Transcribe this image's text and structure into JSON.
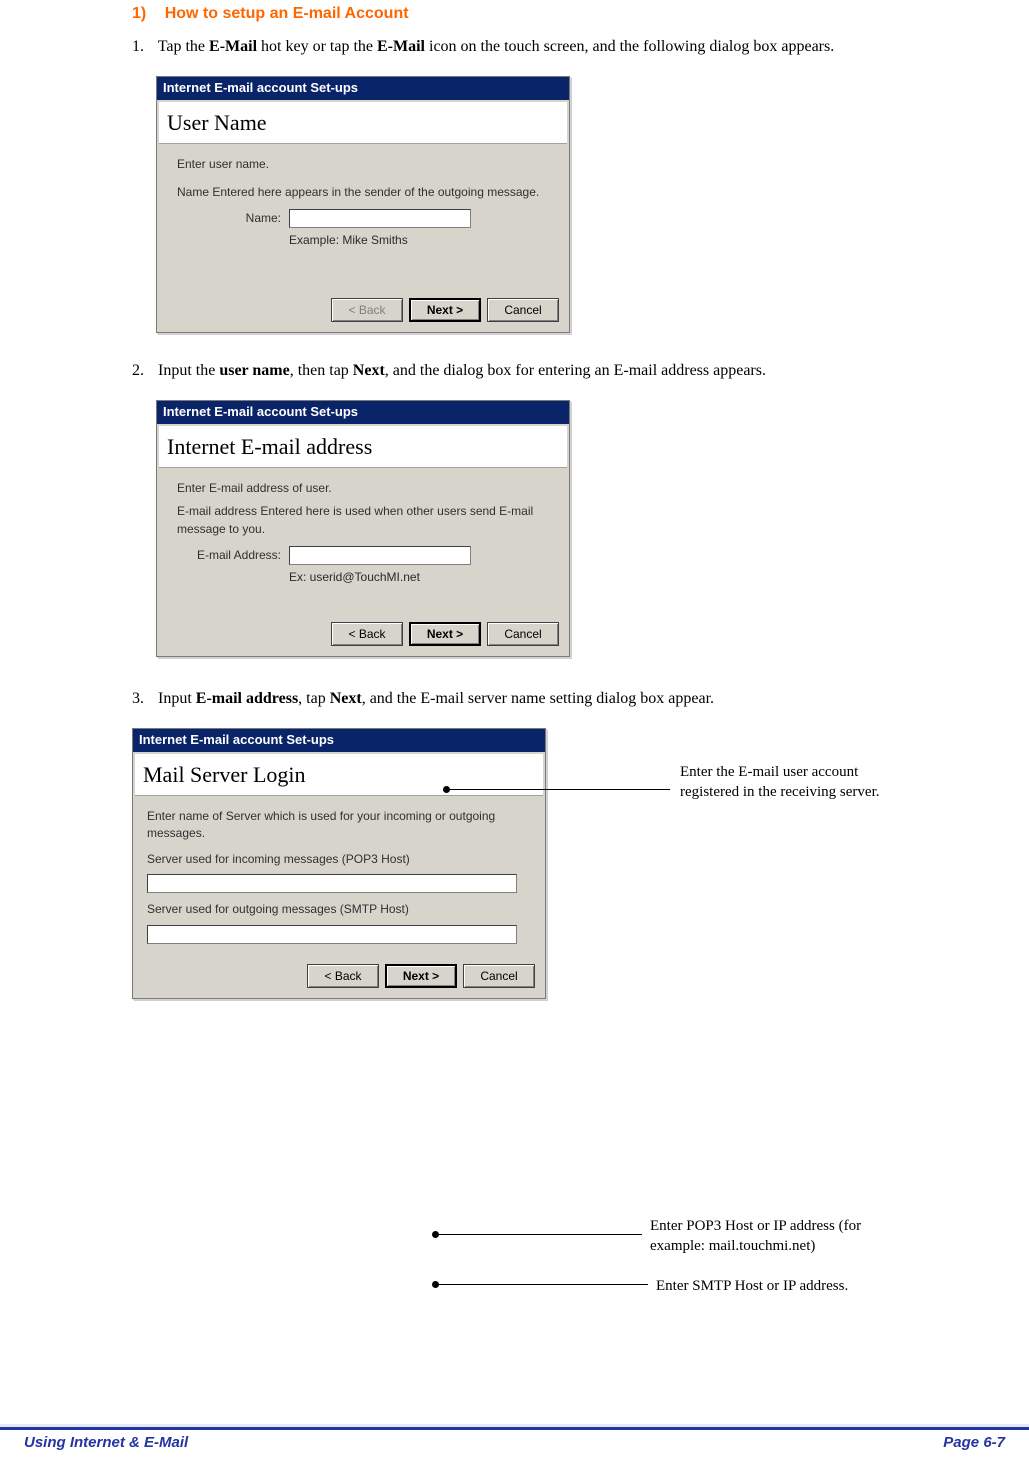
{
  "heading": {
    "num": "1)",
    "text": "How to setup an E-mail Account"
  },
  "steps": {
    "s1_prefix": "1.",
    "s1_a": "Tap the ",
    "s1_b": "E-Mail",
    "s1_c": " hot key or tap the ",
    "s1_d": "E-Mail",
    "s1_e": " icon on the touch screen, and the following dialog box appears.",
    "s2_prefix": "2.",
    "s2_a": "Input the ",
    "s2_b": "user name",
    "s2_c": ", then tap ",
    "s2_d": "Next",
    "s2_e": ", and the dialog box for entering an E-mail address appears.",
    "s3_prefix": "3.",
    "s3_a": "Input ",
    "s3_b": "E-mail address",
    "s3_c": ", tap ",
    "s3_d": "Next",
    "s3_e": ", and the E-mail server name setting dialog box appear."
  },
  "dialogs": {
    "common_title": "Internet E-mail account Set-ups",
    "buttons": {
      "back": "<  Back",
      "next": "Next  >",
      "cancel": "Cancel"
    },
    "d1": {
      "heading": "User Name",
      "line1": "Enter user name.",
      "line2": "Name Entered here appears in the sender of the outgoing message.",
      "field_label": "Name:",
      "example": "Example: Mike Smiths",
      "value": ""
    },
    "d2": {
      "heading": "Internet E-mail address",
      "line1": "Enter E-mail address of user.",
      "line2": "E-mail address Entered here is used when other users send E-mail message to you.",
      "field_label": "E-mail Address:",
      "example": "Ex: userid@TouchMI.net",
      "value": ""
    },
    "d3": {
      "heading": "Mail Server Login",
      "line1": "Enter name of Server which is used for your incoming or outgoing messages.",
      "pop3_label": "Server used for incoming messages (POP3 Host)",
      "smtp_label": "Server used for outgoing messages (SMTP Host)",
      "pop3_value": "",
      "smtp_value": ""
    }
  },
  "callouts": {
    "c1": "Enter the E-mail user account registered in the receiving server.",
    "c2": "Enter POP3 Host or IP address (for example: mail.touchmi.net)",
    "c3": "Enter SMTP Host or IP address."
  },
  "footer": {
    "left": "Using Internet & E-Mail",
    "right": "Page 6-7"
  }
}
